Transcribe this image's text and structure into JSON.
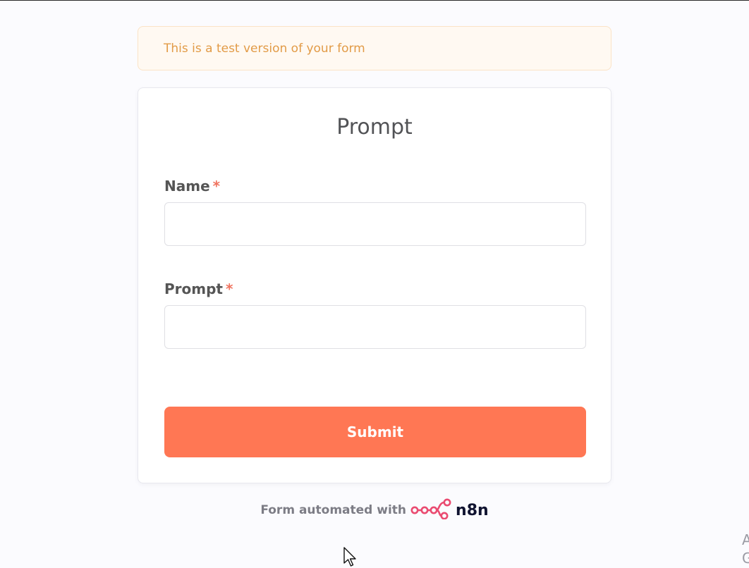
{
  "banner": {
    "text": "This is a test version of your form"
  },
  "form": {
    "title": "Prompt",
    "fields": [
      {
        "label": "Name",
        "required_mark": "*",
        "value": "",
        "placeholder": ""
      },
      {
        "label": "Prompt",
        "required_mark": "*",
        "value": "",
        "placeholder": ""
      }
    ],
    "submit_label": "Submit"
  },
  "footer": {
    "text": "Form automated with",
    "brand_name": "n8n",
    "brand_icon": "n8n-logo-icon"
  },
  "edge_text": {
    "line1": "A",
    "line2": "G"
  },
  "colors": {
    "accent": "#ff7754",
    "required": "#f0735f",
    "banner_text": "#e29b47",
    "banner_bg": "#fff9f2",
    "brand_icon": "#ea4b71"
  }
}
